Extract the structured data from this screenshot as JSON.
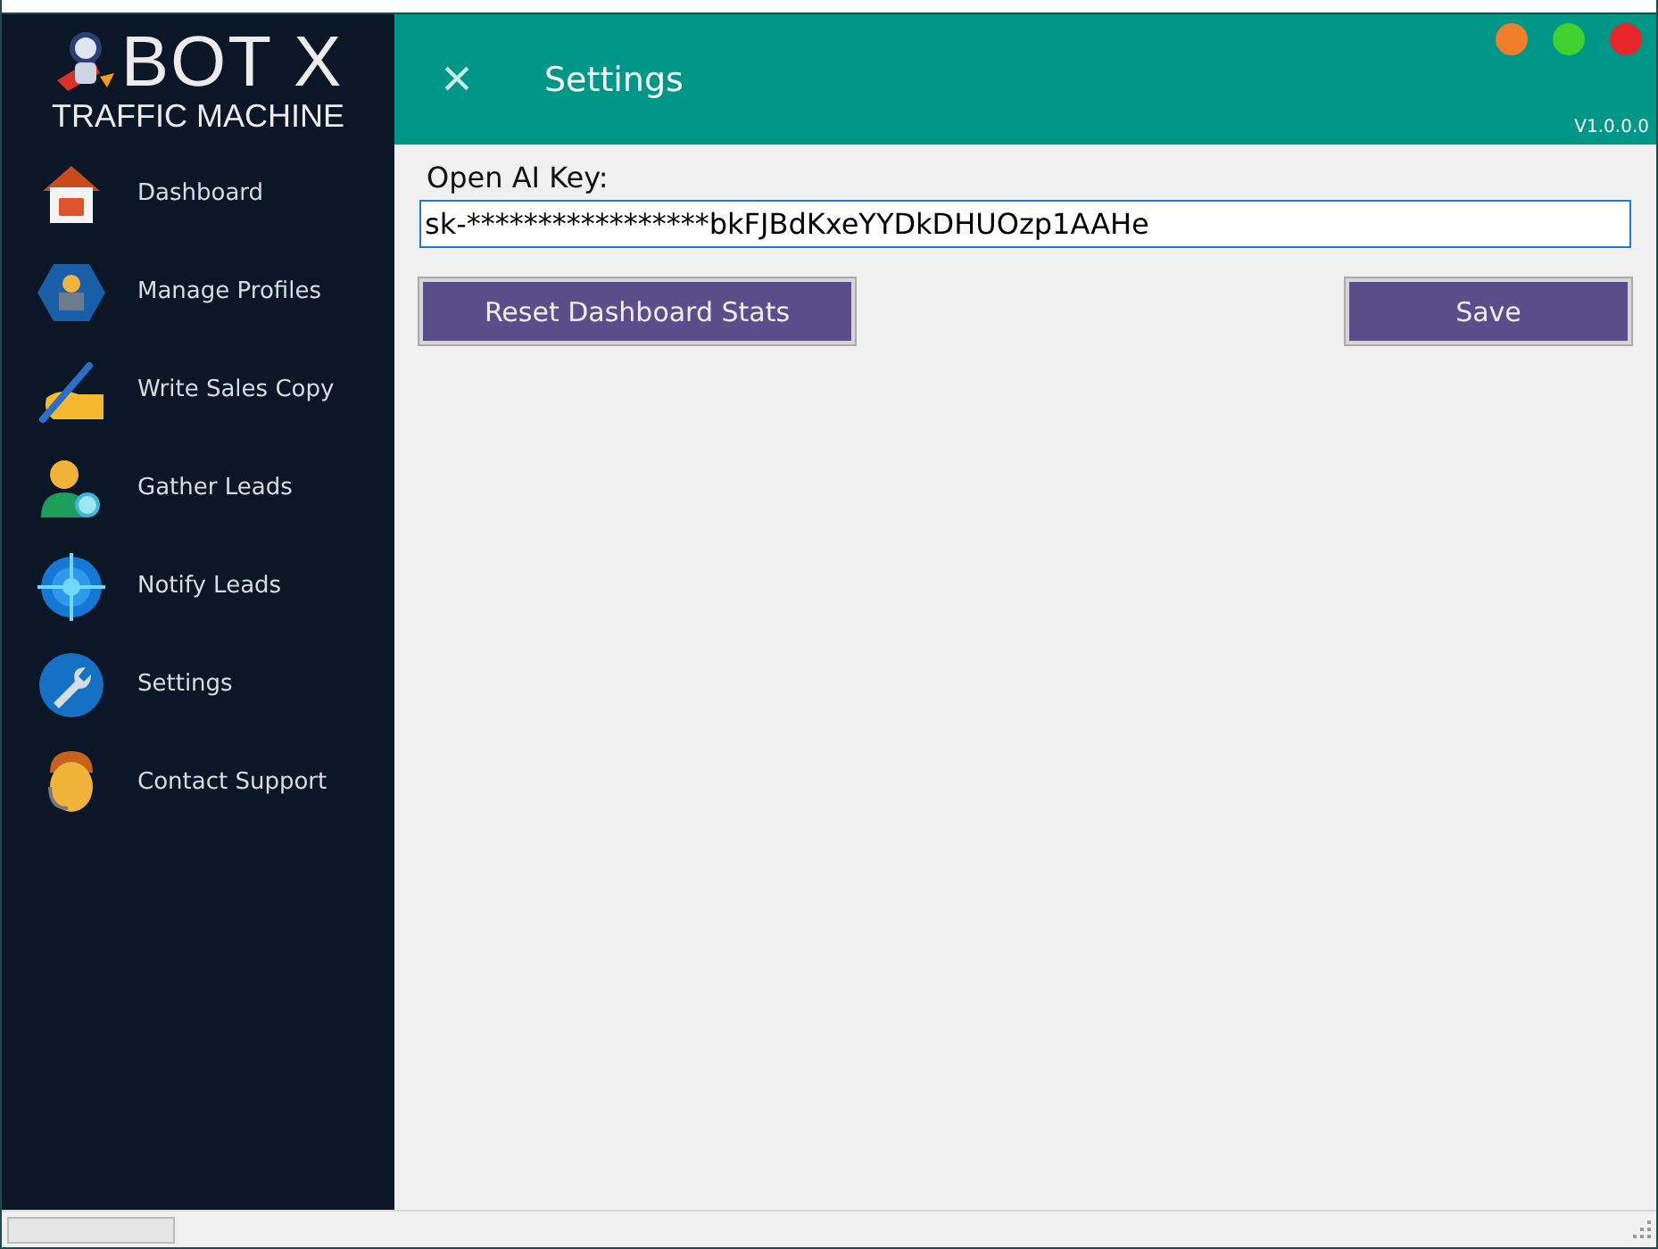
{
  "logo": {
    "title": "BOT X",
    "subtitle": "TRAFFIC MACHINE"
  },
  "sidebar": {
    "items": [
      {
        "label": "Dashboard"
      },
      {
        "label": "Manage Profiles"
      },
      {
        "label": "Write Sales Copy"
      },
      {
        "label": "Gather Leads"
      },
      {
        "label": "Notify Leads"
      },
      {
        "label": "Settings"
      },
      {
        "label": "Contact Support"
      }
    ]
  },
  "header": {
    "close": "×",
    "title": "Settings",
    "version": "V1.0.0.0"
  },
  "form": {
    "label": "Open AI Key:",
    "value": "sk-*****************bkFJBdKxeYYDkDHUOzp1AAHe"
  },
  "buttons": [
    "Reset Dashboard Stats",
    "Save"
  ]
}
